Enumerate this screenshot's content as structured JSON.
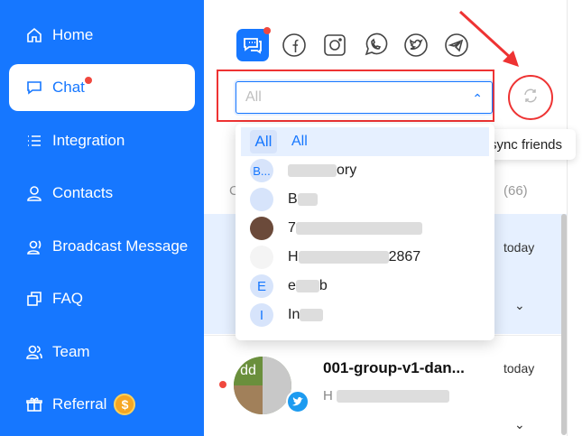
{
  "sidebar": {
    "items": [
      {
        "label": "Home",
        "icon": "home-icon"
      },
      {
        "label": "Chat",
        "icon": "chat-icon"
      },
      {
        "label": "Integration",
        "icon": "list-icon"
      },
      {
        "label": "Contacts",
        "icon": "user-icon"
      },
      {
        "label": "Broadcast Message",
        "icon": "broadcast-icon"
      },
      {
        "label": "FAQ",
        "icon": "faq-icon"
      },
      {
        "label": "Team",
        "icon": "team-icon"
      },
      {
        "label": "Referral",
        "icon": "gift-icon"
      }
    ],
    "referral_coin": "$",
    "accent": "#1677ff"
  },
  "platforms": [
    "chat-icon",
    "facebook-icon",
    "instagram-icon",
    "whatsapp-icon",
    "twitter-icon",
    "telegram-icon"
  ],
  "filter": {
    "value": "All"
  },
  "tooltip": "sync friends",
  "list_header": {
    "tab_letter": "C",
    "count": "(66)"
  },
  "dropdown": {
    "options": [
      {
        "avatar": "All",
        "label": "All"
      },
      {
        "avatar": "B...",
        "label": "ory"
      },
      {
        "avatar": "",
        "label": "B"
      },
      {
        "avatar": "",
        "label": "7"
      },
      {
        "avatar": "",
        "label": "2867"
      },
      {
        "avatar": "E",
        "label": "e"
      },
      {
        "avatar": "I",
        "label": "In"
      }
    ]
  },
  "conversations": [
    {
      "time": "today"
    },
    {
      "title": "001-group-v1-dan...",
      "time": "today",
      "avatar_text": "dd",
      "preview": "H"
    }
  ],
  "colors": {
    "accent": "#1677ff",
    "highlight": "#ee3333",
    "selected": "#e6f0ff"
  }
}
